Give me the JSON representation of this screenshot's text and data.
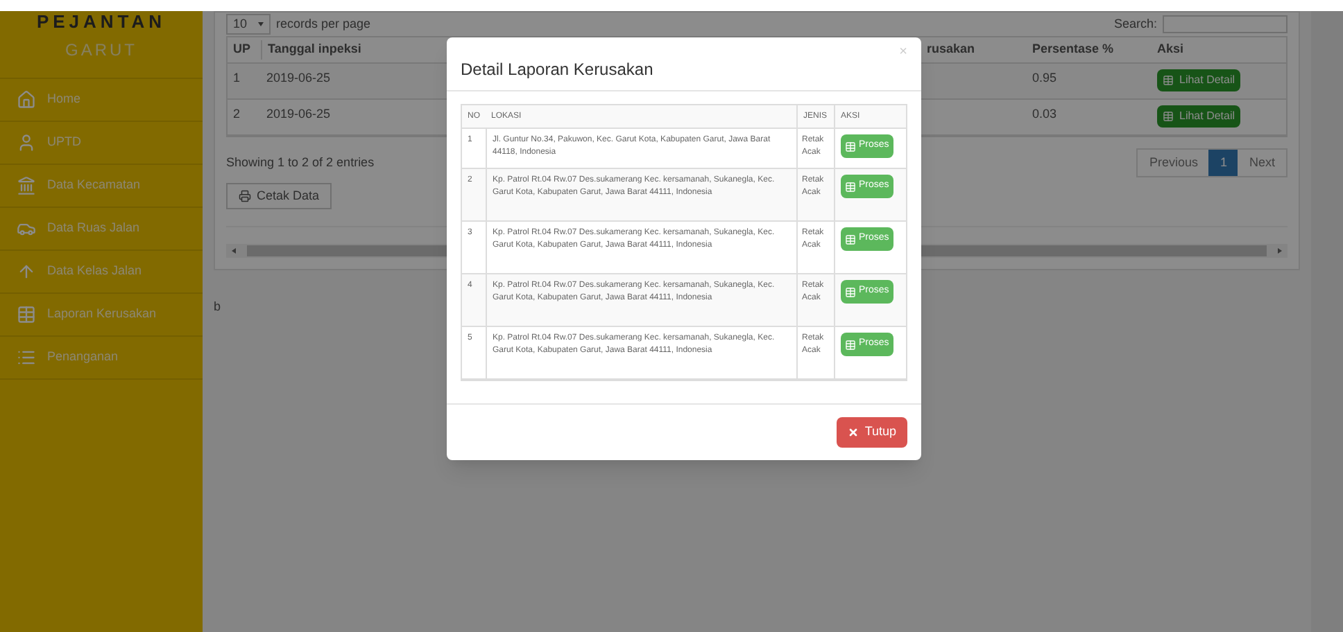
{
  "sidebar": {
    "brand": "PEJANTAN",
    "subtitle": "GARUT",
    "items": [
      {
        "label": "Home"
      },
      {
        "label": "UPTD"
      },
      {
        "label": "Data Kecamatan"
      },
      {
        "label": "Data Ruas Jalan"
      },
      {
        "label": "Data Kelas Jalan"
      },
      {
        "label": "Laporan Kerusakan"
      },
      {
        "label": "Penanganan"
      }
    ]
  },
  "page": {
    "length_select": "10",
    "length_label": "records per page",
    "search_label": "Search:",
    "table": {
      "columns": [
        "UP",
        "Tanggal inpeksi",
        "rusakan",
        "Persentase %",
        "Aksi"
      ],
      "rows": [
        {
          "up": "1",
          "date": "2019-06-25",
          "percent": "0.95",
          "action": "Lihat Detail"
        },
        {
          "up": "2",
          "date": "2019-06-25",
          "percent": "0.03",
          "action": "Lihat Detail"
        }
      ]
    },
    "info": "Showing 1 to 2 of 2 entries",
    "print_button": "Cetak Data",
    "pagination": [
      {
        "label": "Previous",
        "selected": false
      },
      {
        "label": "1",
        "selected": true
      },
      {
        "label": "Next",
        "selected": false
      }
    ],
    "stray_text": "b"
  },
  "modal": {
    "title": "Detail Laporan Kerusakan",
    "close": "×",
    "columns": [
      "NO",
      "LOKASI",
      "JENIS",
      "AKSI"
    ],
    "rows": [
      {
        "no": "1",
        "lokasi": "Jl. Guntur No.34, Pakuwon, Kec. Garut Kota, Kabupaten Garut, Jawa Barat 44118, Indonesia",
        "jenis": "Retak Acak",
        "action": "Proses"
      },
      {
        "no": "2",
        "lokasi": "Kp. Patrol Rt.04 Rw.07 Des.sukamerang Kec. kersamanah, Sukanegla, Kec. Garut Kota, Kabupaten Garut, Jawa Barat 44111, Indonesia",
        "jenis": "Retak Acak",
        "action": "Proses"
      },
      {
        "no": "3",
        "lokasi": "Kp. Patrol Rt.04 Rw.07 Des.sukamerang Kec. kersamanah, Sukanegla, Kec. Garut Kota, Kabupaten Garut, Jawa Barat 44111, Indonesia",
        "jenis": "Retak Acak",
        "action": "Proses"
      },
      {
        "no": "4",
        "lokasi": "Kp. Patrol Rt.04 Rw.07 Des.sukamerang Kec. kersamanah, Sukanegla, Kec. Garut Kota, Kabupaten Garut, Jawa Barat 44111, Indonesia",
        "jenis": "Retak Acak",
        "action": "Proses"
      },
      {
        "no": "5",
        "lokasi": "Kp. Patrol Rt.04 Rw.07 Des.sukamerang Kec. kersamanah, Sukanegla, Kec. Garut Kota, Kabupaten Garut, Jawa Barat 44111, Indonesia",
        "jenis": "Retak Acak",
        "action": "Proses"
      }
    ],
    "footer_button": "Tutup"
  }
}
